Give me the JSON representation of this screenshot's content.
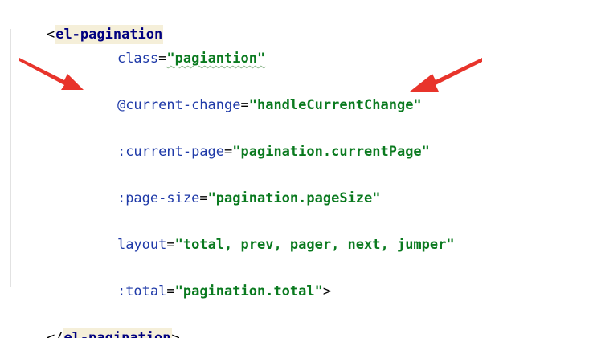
{
  "code": {
    "open_lt": "<",
    "open_tag": "el-pagination",
    "lines": [
      {
        "attr": "class",
        "eq": "=",
        "value": "\"pagiantion\""
      },
      {
        "attr": "@current-change",
        "eq": "=",
        "value": "\"handleCurrentChange\""
      },
      {
        "attr": ":current-page",
        "eq": "=",
        "value": "\"pagination.currentPage\""
      },
      {
        "attr": ":page-size",
        "eq": "=",
        "value": "\"pagination.pageSize\""
      },
      {
        "attr": "layout",
        "eq": "=",
        "value": "\"total, prev, pager, next, jumper\""
      },
      {
        "attr": ":total",
        "eq": "=",
        "value": "\"pagination.total\"",
        "close": ">"
      }
    ],
    "close_lt": "</",
    "close_tag": "el-pagination",
    "close_gt": ">"
  },
  "annotations": {
    "arrow_color": "#e8342b",
    "arrow_icon": "red-arrow"
  }
}
